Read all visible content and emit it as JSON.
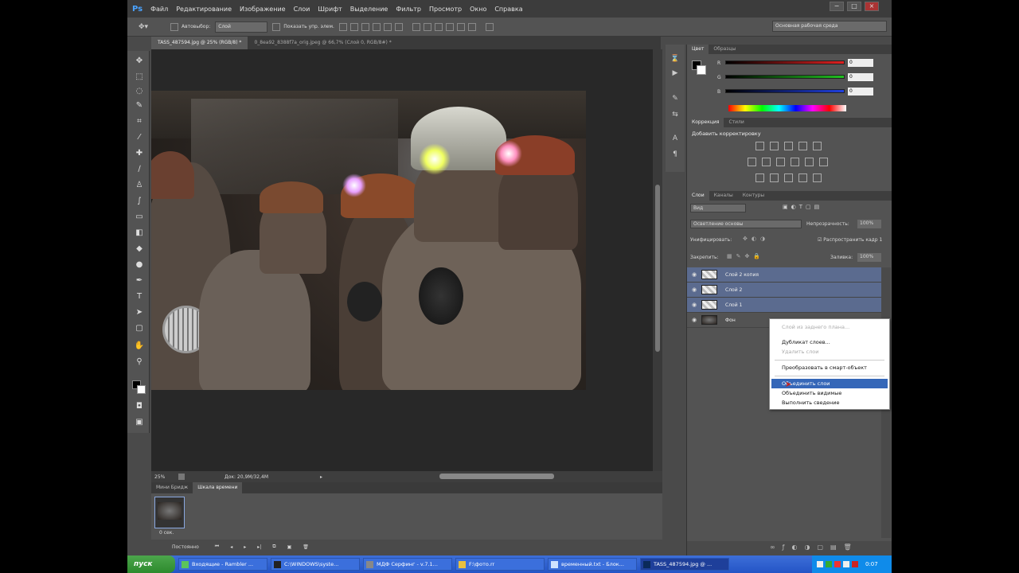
{
  "app": {
    "logo": "Ps",
    "menu": [
      "Файл",
      "Редактирование",
      "Изображение",
      "Слои",
      "Шрифт",
      "Выделение",
      "Фильтр",
      "Просмотр",
      "Окно",
      "Справка"
    ],
    "window_buttons": [
      "−",
      "□",
      "×"
    ]
  },
  "options_bar": {
    "auto_select_label": "Автовыбор:",
    "auto_select_value": "Слой",
    "show_controls_label": "Показать упр. элем.",
    "workspace": "Основная рабочая среда"
  },
  "doc_tabs": [
    {
      "label": "TASS_487594.jpg @ 25% (RGB/8) *",
      "active": true
    },
    {
      "label": "0_8ea92_8388f7a_orig.jpeg @ 66,7% (Слой 0, RGB/8#) *",
      "active": false
    }
  ],
  "status": {
    "zoom": "25%",
    "doc": "Док: 20,9M/32,4M"
  },
  "timeline": {
    "tabs": [
      "Мини Бридж",
      "Шкала времени"
    ],
    "frame_time": "0 сек.",
    "loop": "Постоянно"
  },
  "color_panel": {
    "tabs": [
      "Цвет",
      "Образцы"
    ],
    "channels": [
      {
        "label": "R",
        "value": "0",
        "color": "#c81e1e"
      },
      {
        "label": "G",
        "value": "0",
        "color": "#1eaa1e"
      },
      {
        "label": "B",
        "value": "0",
        "color": "#1e32c8"
      }
    ]
  },
  "corrections_panel": {
    "tabs": [
      "Коррекция",
      "Стили"
    ],
    "title": "Добавить корректировку"
  },
  "layers_panel": {
    "tabs": [
      "Слои",
      "Каналы",
      "Контуры"
    ],
    "kind_filter": "Вид",
    "blend_mode": "Осветление основы",
    "opacity_label": "Непрозрачность:",
    "opacity_value": "100%",
    "unify_label": "Унифицировать:",
    "propagate_label": "Распространить кадр 1",
    "lock_label": "Закрепить:",
    "fill_label": "Заливка:",
    "fill_value": "100%",
    "layers": [
      {
        "name": "Слой 2 копия",
        "selected": true
      },
      {
        "name": "Слой 2",
        "selected": true
      },
      {
        "name": "Слой 1",
        "selected": true
      },
      {
        "name": "Фон",
        "selected": false
      }
    ]
  },
  "context_menu": {
    "items": [
      {
        "label": "Слой из заднего плана...",
        "disabled": true
      },
      {
        "label": "Дубликат слоев...",
        "disabled": false
      },
      {
        "label": "Удалить слои",
        "disabled": true
      },
      {
        "label": "Преобразовать в смарт-объект",
        "disabled": false
      },
      {
        "label": "Объединить слои",
        "disabled": false,
        "highlighted": true
      },
      {
        "label": "Объединить видимые",
        "disabled": false
      },
      {
        "label": "Выполнить сведение",
        "disabled": false
      }
    ]
  },
  "taskbar": {
    "start": "пуск",
    "tasks": [
      {
        "label": "Входящие - Rambler ...",
        "active": false
      },
      {
        "label": "C:\\WINDOWS\\syste...",
        "active": false
      },
      {
        "label": "МДФ Серфинг - v.7.1...",
        "active": false
      },
      {
        "label": "F:\\фото.rr",
        "active": false
      },
      {
        "label": "временный.txt - Блок...",
        "active": false
      },
      {
        "label": "TASS_487594.jpg @ ...",
        "active": true
      }
    ],
    "clock": "0:07"
  }
}
